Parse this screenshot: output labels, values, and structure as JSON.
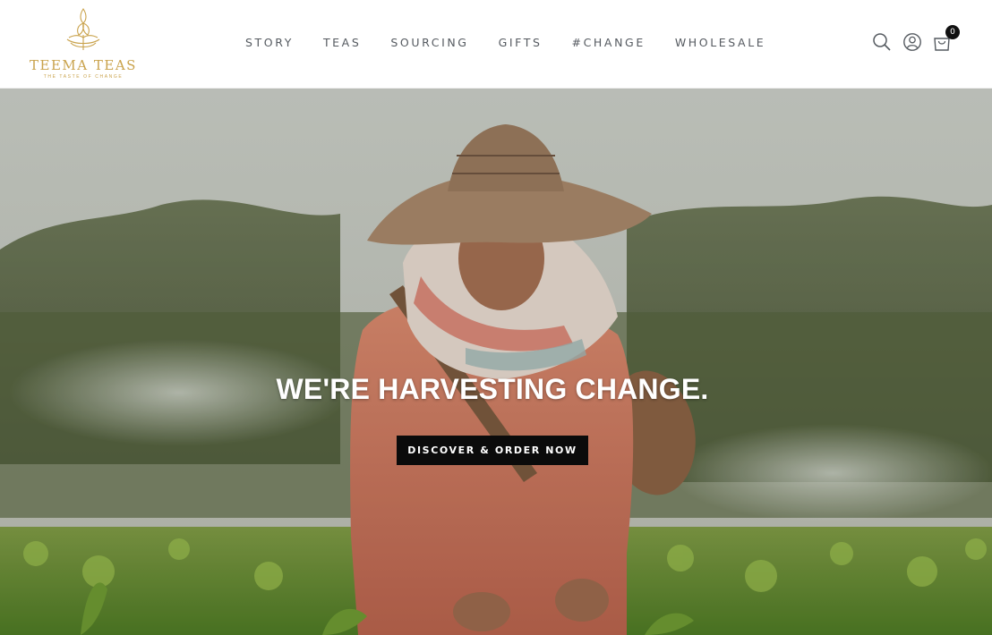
{
  "brand": {
    "name": "TEEMA TEAS",
    "tagline": "THE TASTE OF CHANGE",
    "logo_icon": "tea-leaf-lotus-icon",
    "color": "#c9a24b"
  },
  "nav": {
    "items": [
      {
        "label": "STORY"
      },
      {
        "label": "TEAS"
      },
      {
        "label": "SOURCING"
      },
      {
        "label": "GIFTS"
      },
      {
        "label": "#CHANGE"
      },
      {
        "label": "WHOLESALE"
      }
    ]
  },
  "header_icons": {
    "search": "search-icon",
    "account": "account-icon",
    "cart": "cart-icon",
    "cart_count": "0"
  },
  "hero": {
    "title": "WE'RE HARVESTING CHANGE.",
    "cta_label": "DISCOVER & ORDER NOW",
    "image": "tea-picker-in-field-photo"
  }
}
